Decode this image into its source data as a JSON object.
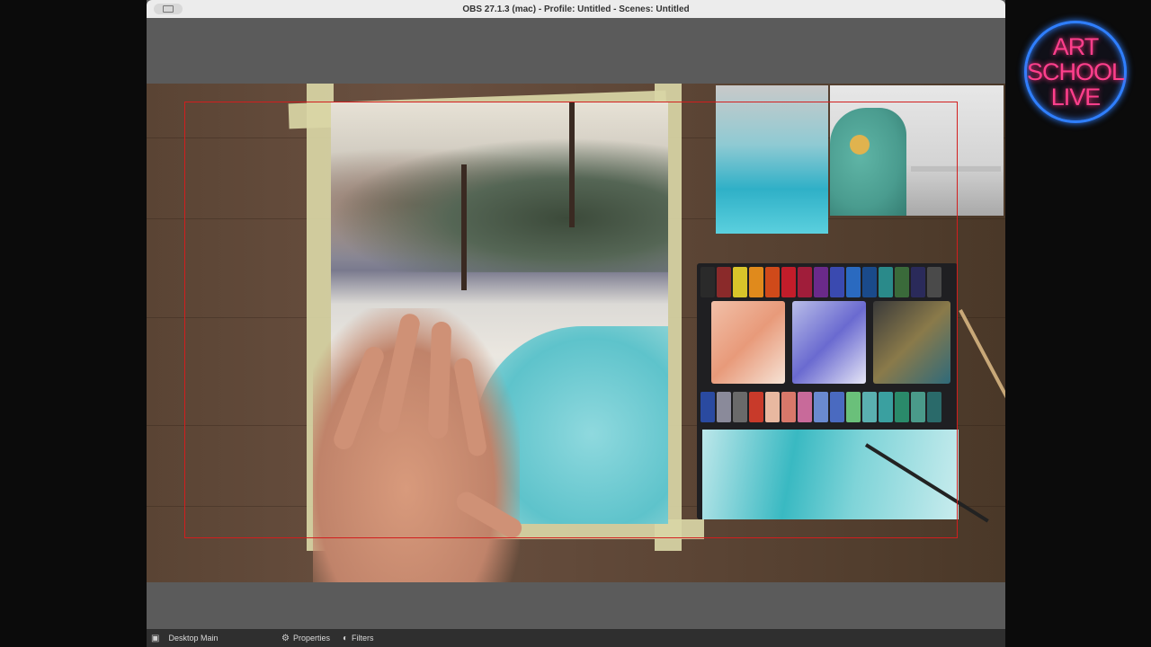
{
  "window": {
    "title": "OBS 27.1.3 (mac) - Profile: Untitled - Scenes: Untitled"
  },
  "bottombar": {
    "source_name": "Desktop Main",
    "properties_label": "Properties",
    "filters_label": "Filters"
  },
  "overlay_logo": {
    "line1": "ART",
    "line2": "SCHOOL",
    "line3": "LIVE",
    "color": "#ff3f8c",
    "ring_color": "#2f7fff"
  },
  "colors": {
    "selection_frame": "#d21e1e"
  },
  "icons": {
    "source_icon": "monitor-icon",
    "properties_icon": "gear-icon",
    "filters_icon": "filter-icon"
  }
}
